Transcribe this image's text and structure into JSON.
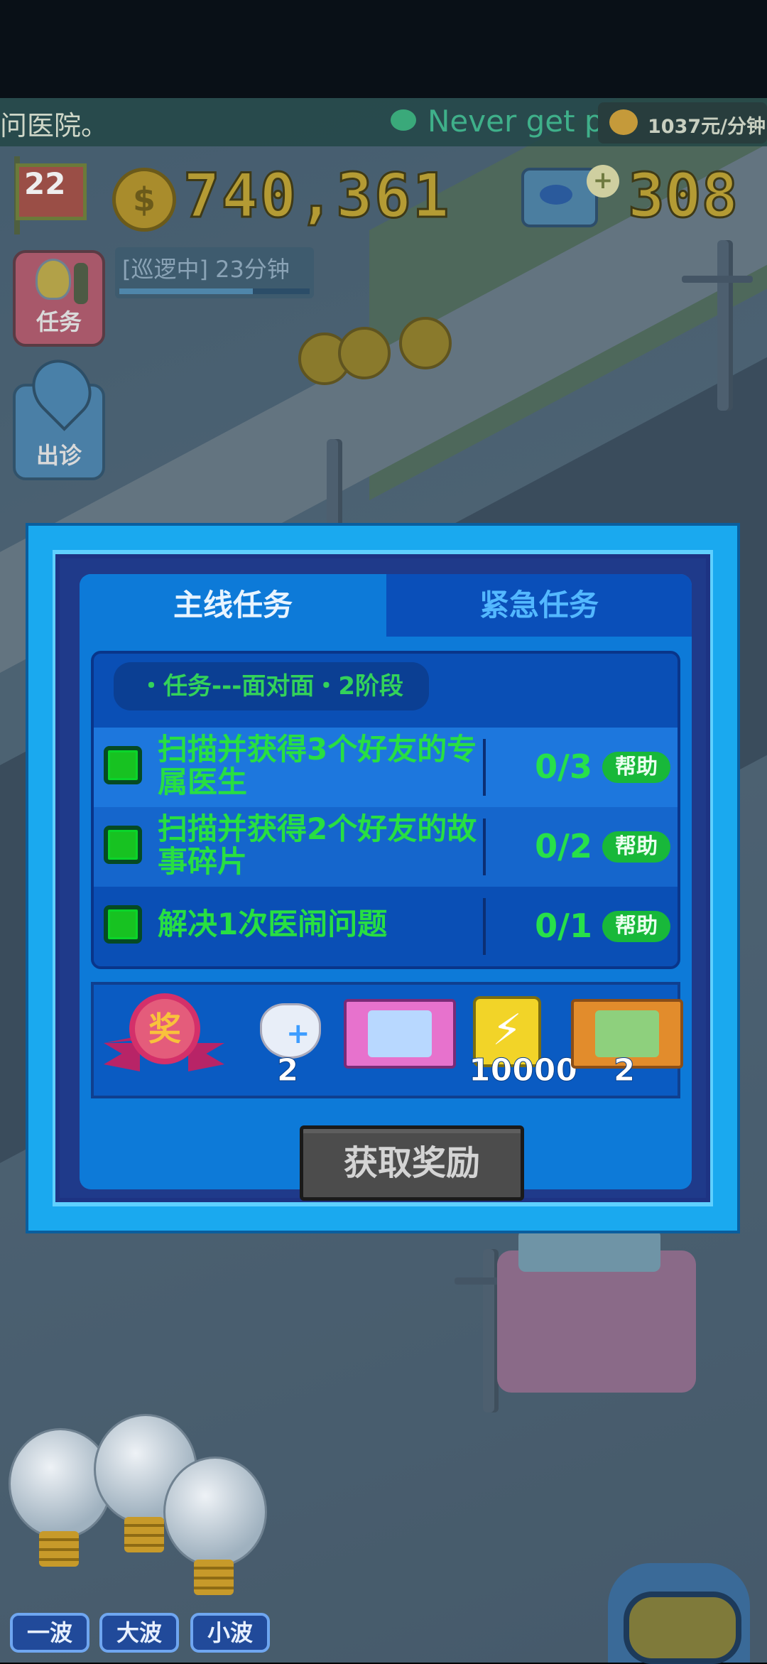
{
  "ticker": {
    "left_text": "问医院。",
    "right_text": "Never get p",
    "income": "1037元/分钟"
  },
  "hud": {
    "level": "22",
    "money": "740,361",
    "gems": "308",
    "coin_symbol": "$",
    "gem_plus": "+"
  },
  "side_buttons": {
    "task_label": "任务",
    "clinic_label": "出诊"
  },
  "patrol": {
    "text": "[巡逻中] 23分钟",
    "progress": 0.7
  },
  "dialog": {
    "tabs": [
      {
        "label": "主线任务",
        "active": true
      },
      {
        "label": "紧急任务",
        "active": false
      }
    ],
    "stage_label": "・任务---面对面・2阶段",
    "tasks": [
      {
        "text": "扫描并获得3个好友的专属医生",
        "progress": "0/3",
        "help": "帮助"
      },
      {
        "text": "扫描并获得2个好友的故事碎片",
        "progress": "0/2",
        "help": "帮助"
      },
      {
        "text": "解决1次医闹问题",
        "progress": "0/1",
        "help": "帮助"
      }
    ],
    "rewards": {
      "medal_char": "奖",
      "items": [
        {
          "icon": "cat-plus-icon",
          "qty": "2"
        },
        {
          "icon": "pink-card-icon",
          "qty": ""
        },
        {
          "icon": "lightning-icon",
          "qty": "10000"
        },
        {
          "icon": "orange-card-icon",
          "qty": "2"
        }
      ]
    },
    "claim_label": "获取奖励"
  },
  "bottom": {
    "waves": [
      "一波",
      "大波",
      "小波"
    ]
  },
  "colors": {
    "dialog_outer": "#1aa9ef",
    "task_green": "#28df42",
    "help_green": "#18b83a",
    "claim_gray": "#4c4c4c"
  }
}
